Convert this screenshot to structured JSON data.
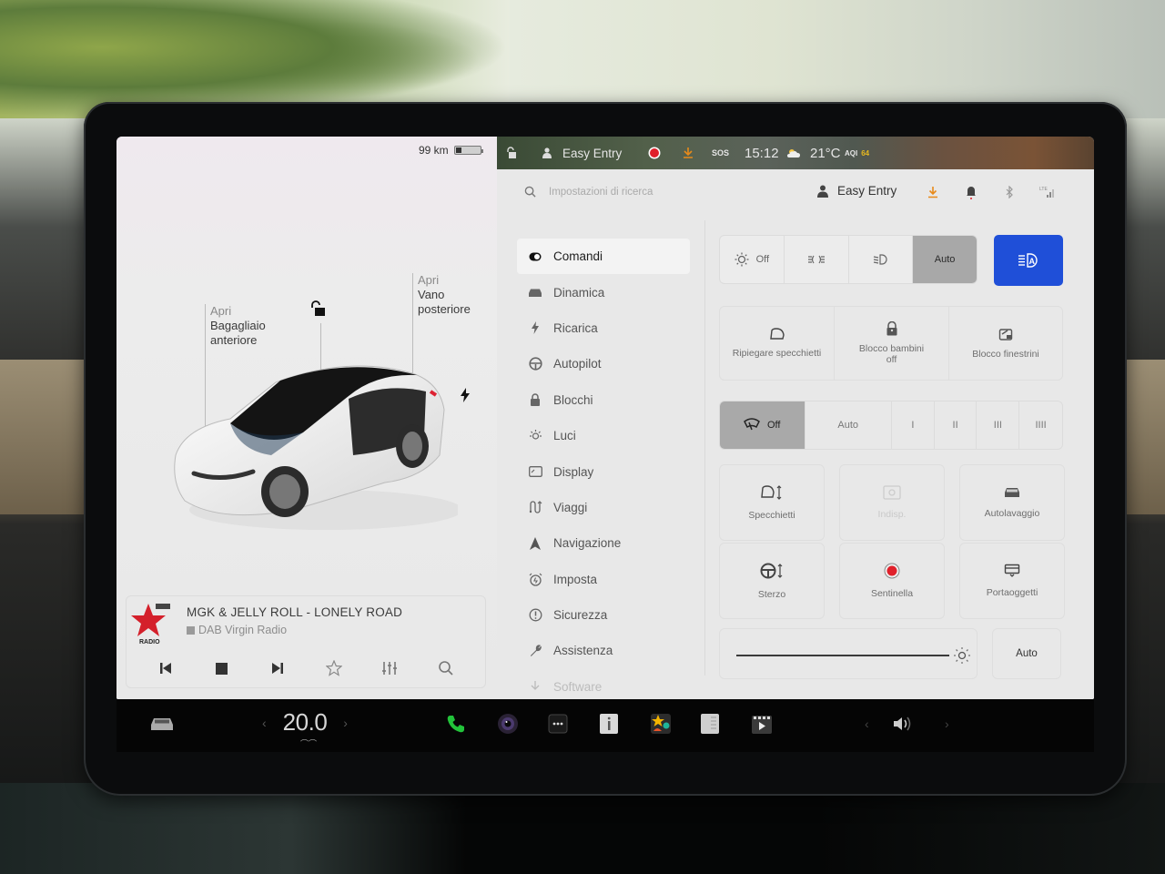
{
  "car_panel": {
    "range": "99 km",
    "frunk": {
      "action": "Apri",
      "label_line1": "Bagagliaio",
      "label_line2": "anteriore"
    },
    "trunk": {
      "action": "Apri",
      "label_line1": "Vano",
      "label_line2": "posteriore"
    },
    "lock_state": "unlocked",
    "charge_port_icon": "lightning-icon"
  },
  "media": {
    "song": "MGK & JELLY ROLL - LONELY ROAD",
    "source": "DAB Virgin Radio",
    "station_logo_text": "RADIO",
    "controls": [
      "previous",
      "stop",
      "next",
      "favorite",
      "equalizer",
      "search"
    ]
  },
  "status_bar": {
    "profile": "Easy Entry",
    "time": "15:12",
    "temperature": "21°C",
    "sos": "SOS",
    "aqi_label": "AQI",
    "aqi_value": "64"
  },
  "settings": {
    "search_placeholder": "Impostazioni di ricerca",
    "profile": "Easy Entry",
    "nav": [
      {
        "label": "Comandi",
        "icon": "toggle-icon",
        "active": true
      },
      {
        "label": "Dinamica",
        "icon": "car-icon"
      },
      {
        "label": "Ricarica",
        "icon": "lightning-icon"
      },
      {
        "label": "Autopilot",
        "icon": "steering-wheel-icon"
      },
      {
        "label": "Blocchi",
        "icon": "lock-icon"
      },
      {
        "label": "Luci",
        "icon": "light-bulb-icon"
      },
      {
        "label": "Display",
        "icon": "display-icon"
      },
      {
        "label": "Viaggi",
        "icon": "trips-icon"
      },
      {
        "label": "Navigazione",
        "icon": "navigation-arrow-icon"
      },
      {
        "label": "Imposta",
        "icon": "alarm-clock-icon"
      },
      {
        "label": "Sicurezza",
        "icon": "alert-circle-icon"
      },
      {
        "label": "Assistenza",
        "icon": "wrench-icon"
      },
      {
        "label": "Software",
        "icon": "download-icon"
      }
    ],
    "headlights": {
      "options": [
        "Off",
        "",
        "",
        "Auto"
      ],
      "selected": "Auto",
      "auto_high_beam": "on"
    },
    "row1": [
      {
        "label": "Ripiegare specchietti",
        "icon": "mirror-icon"
      },
      {
        "label": "Blocco bambini",
        "sub": "off",
        "icon": "child-lock-icon"
      },
      {
        "label": "Blocco finestrini",
        "icon": "window-lock-icon"
      }
    ],
    "wipers": {
      "options": [
        "Off",
        "Auto",
        "I",
        "II",
        "III",
        "IIII"
      ],
      "selected": "Off"
    },
    "tiles": [
      {
        "label": "Specchietti",
        "icon": "mirror-adjust-icon"
      },
      {
        "label": "Indisp.",
        "icon": "camera-icon",
        "disabled": true
      },
      {
        "label": "Autolavaggio",
        "icon": "car-wash-icon"
      },
      {
        "label": "Sterzo",
        "icon": "steering-adjust-icon"
      },
      {
        "label": "Sentinella",
        "icon": "sentry-icon"
      },
      {
        "label": "Portaoggetti",
        "icon": "glovebox-icon"
      }
    ],
    "brightness": {
      "level_percent": 100,
      "auto_label": "Auto"
    }
  },
  "dock": {
    "cabin_temp": "20.0",
    "apps": [
      "phone",
      "camera",
      "more",
      "manual",
      "toybox",
      "calendar",
      "theater"
    ],
    "volume_icon": "speaker-icon"
  },
  "colors": {
    "accent_blue": "#1f4fd8",
    "sentry_red": "#e0202a",
    "phone_green": "#22c33a",
    "download_orange": "#e88a1a"
  }
}
